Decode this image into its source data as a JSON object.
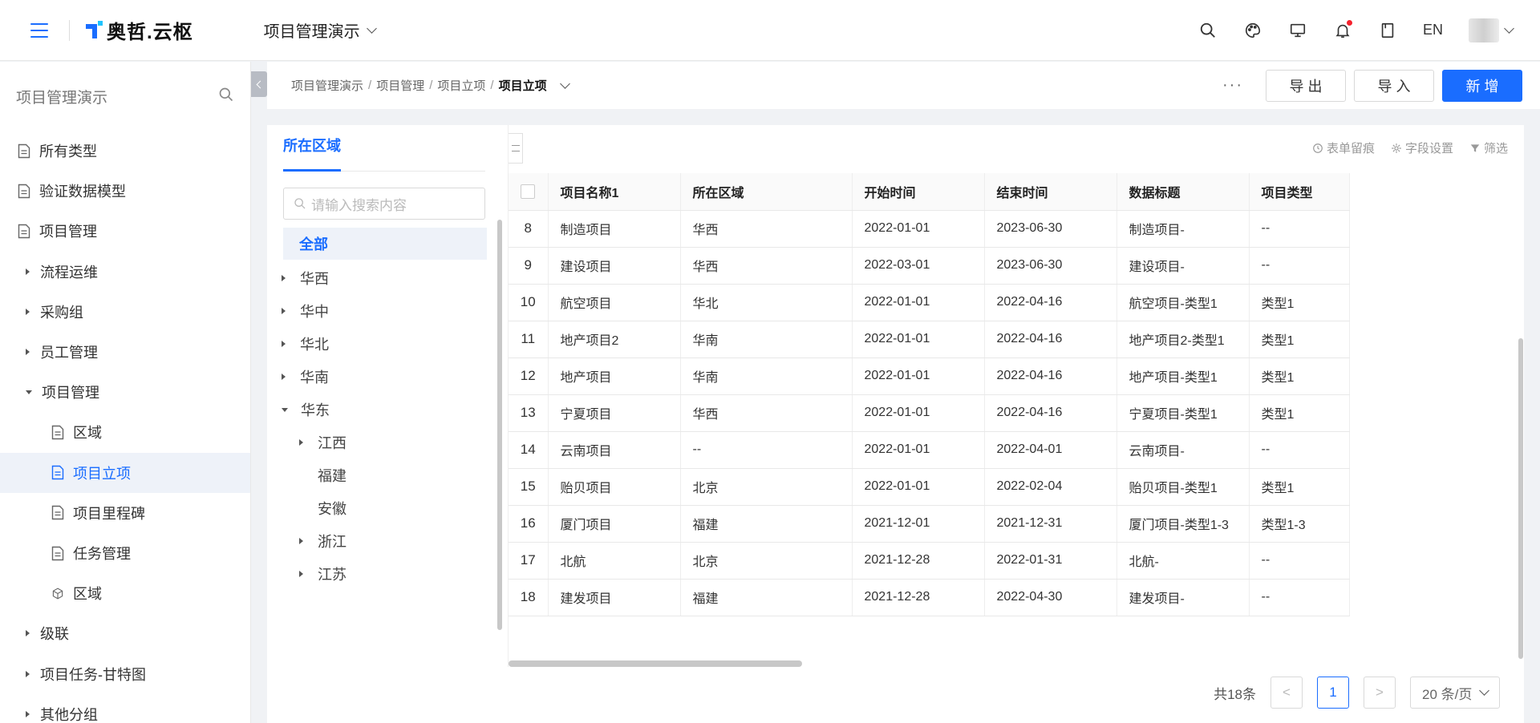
{
  "header": {
    "logo_text": "奥哲.云枢",
    "app_name": "项目管理演示",
    "lang": "EN"
  },
  "sidebar": {
    "title": "项目管理演示",
    "items": [
      {
        "label": "所有类型",
        "kind": "doc",
        "level": 0
      },
      {
        "label": "验证数据模型",
        "kind": "doc",
        "level": 0
      },
      {
        "label": "项目管理",
        "kind": "doc",
        "level": 0
      },
      {
        "label": "流程运维",
        "kind": "group-collapsed",
        "level": 0
      },
      {
        "label": "采购组",
        "kind": "group-collapsed",
        "level": 0
      },
      {
        "label": "员工管理",
        "kind": "group-collapsed",
        "level": 0
      },
      {
        "label": "项目管理",
        "kind": "group-expanded",
        "level": 0
      },
      {
        "label": "区域",
        "kind": "doc",
        "level": 1
      },
      {
        "label": "项目立项",
        "kind": "doc",
        "level": 1,
        "active": true
      },
      {
        "label": "项目里程碑",
        "kind": "doc",
        "level": 1
      },
      {
        "label": "任务管理",
        "kind": "doc",
        "level": 1
      },
      {
        "label": "区域",
        "kind": "cube",
        "level": 1
      },
      {
        "label": "级联",
        "kind": "group-collapsed",
        "level": 0
      },
      {
        "label": "项目任务-甘特图",
        "kind": "group-collapsed",
        "level": 0
      },
      {
        "label": "其他分组",
        "kind": "group-collapsed",
        "level": 0
      }
    ]
  },
  "breadcrumb": {
    "items": [
      "项目管理演示",
      "项目管理",
      "项目立项"
    ],
    "current": "项目立项"
  },
  "actions": {
    "more": "···",
    "export": "导 出",
    "import": "导 入",
    "add": "新 增"
  },
  "tree": {
    "tab": "所在区域",
    "search_placeholder": "请输入搜索内容",
    "all": "全部",
    "nodes": [
      {
        "label": "华西",
        "level": 0,
        "toggle": "collapsed"
      },
      {
        "label": "华中",
        "level": 0,
        "toggle": "collapsed"
      },
      {
        "label": "华北",
        "level": 0,
        "toggle": "collapsed"
      },
      {
        "label": "华南",
        "level": 0,
        "toggle": "collapsed"
      },
      {
        "label": "华东",
        "level": 0,
        "toggle": "expanded"
      },
      {
        "label": "江西",
        "level": 1,
        "toggle": "collapsed"
      },
      {
        "label": "福建",
        "level": 1,
        "toggle": "none"
      },
      {
        "label": "安徽",
        "level": 1,
        "toggle": "none"
      },
      {
        "label": "浙江",
        "level": 1,
        "toggle": "collapsed"
      },
      {
        "label": "江苏",
        "level": 1,
        "toggle": "collapsed"
      }
    ]
  },
  "table_tools": {
    "trace": "表单留痕",
    "fields": "字段设置",
    "filter": "筛选"
  },
  "table": {
    "columns": [
      "项目名称1",
      "所在区域",
      "开始时间",
      "结束时间",
      "数据标题",
      "项目类型"
    ],
    "rows": [
      {
        "no": "8",
        "cells": [
          "制造项目",
          "华西",
          "2022-01-01",
          "2023-06-30",
          "制造项目-",
          "--"
        ]
      },
      {
        "no": "9",
        "cells": [
          "建设项目",
          "华西",
          "2022-03-01",
          "2023-06-30",
          "建设项目-",
          "--"
        ]
      },
      {
        "no": "10",
        "cells": [
          "航空项目",
          "华北",
          "2022-01-01",
          "2022-04-16",
          "航空项目-类型1",
          "类型1"
        ]
      },
      {
        "no": "11",
        "cells": [
          "地产项目2",
          "华南",
          "2022-01-01",
          "2022-04-16",
          "地产项目2-类型1",
          "类型1"
        ]
      },
      {
        "no": "12",
        "cells": [
          "地产项目",
          "华南",
          "2022-01-01",
          "2022-04-16",
          "地产项目-类型1",
          "类型1"
        ]
      },
      {
        "no": "13",
        "cells": [
          "宁夏项目",
          "华西",
          "2022-01-01",
          "2022-04-16",
          "宁夏项目-类型1",
          "类型1"
        ]
      },
      {
        "no": "14",
        "cells": [
          "云南项目",
          "--",
          "2022-01-01",
          "2022-04-01",
          "云南项目-",
          "--"
        ]
      },
      {
        "no": "15",
        "cells": [
          "贻贝项目",
          "北京",
          "2022-01-01",
          "2022-02-04",
          "贻贝项目-类型1",
          "类型1"
        ]
      },
      {
        "no": "16",
        "cells": [
          "厦门项目",
          "福建",
          "2021-12-01",
          "2021-12-31",
          "厦门项目-类型1-3",
          "类型1-3"
        ]
      },
      {
        "no": "17",
        "cells": [
          "北航",
          "北京",
          "2021-12-28",
          "2022-01-31",
          "北航-",
          "--"
        ]
      },
      {
        "no": "18",
        "cells": [
          "建发项目",
          "福建",
          "2021-12-28",
          "2022-04-30",
          "建发项目-",
          "--"
        ]
      }
    ]
  },
  "pagination": {
    "total": "共18条",
    "current_page": "1",
    "page_size": "20 条/页",
    "prev": "<",
    "next": ">"
  },
  "colors": {
    "accent": "#1a6dff",
    "active_bg": "#eef2f9",
    "notification_dot": "#f5222d"
  }
}
